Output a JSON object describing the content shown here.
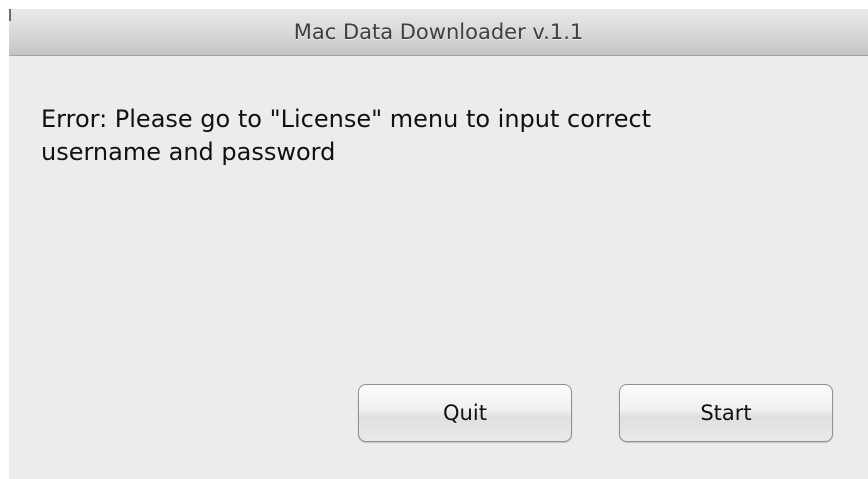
{
  "window": {
    "title": "Mac Data Downloader v.1.1"
  },
  "message": {
    "line1": "Error: Please go to \"License\" menu to input correct",
    "line2": "username and password"
  },
  "buttons": {
    "quit_label": "Quit",
    "start_label": "Start"
  },
  "colors": {
    "window_background": "#ececec",
    "titlebar_top": "#e9e9e9",
    "titlebar_bottom": "#c4c4c4",
    "text": "#111111"
  }
}
